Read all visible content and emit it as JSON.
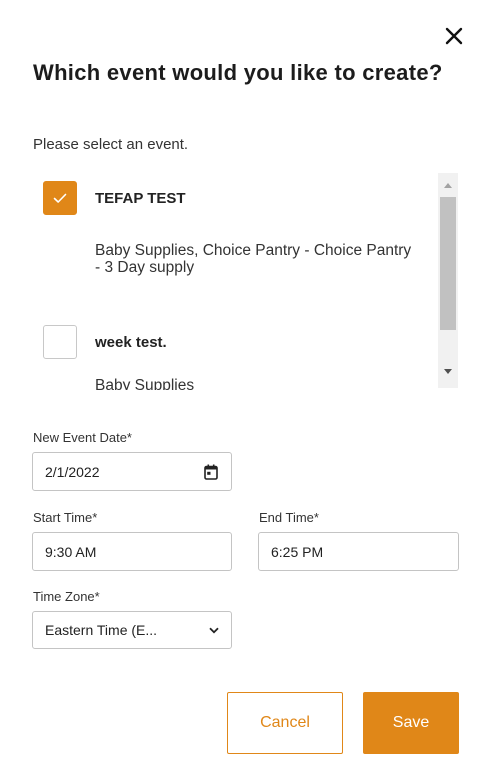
{
  "dialog": {
    "title": "Which event would you like to create?",
    "subtitle": "Please select an event.",
    "close_icon": "close-icon"
  },
  "events": [
    {
      "name": "TEFAP TEST",
      "description": "Baby Supplies, Choice Pantry - Choice Pantry - 3 Day supply",
      "checked": true
    },
    {
      "name": "week test.",
      "description": "Baby Supplies",
      "checked": false
    }
  ],
  "form": {
    "date_label": "New Event Date*",
    "date_value": "2/1/2022",
    "start_label": "Start Time*",
    "start_value": "9:30 AM",
    "end_label": "End Time*",
    "end_value": "6:25 PM",
    "tz_label": "Time Zone*",
    "tz_value": "Eastern Time (E..."
  },
  "buttons": {
    "cancel": "Cancel",
    "save": "Save"
  },
  "colors": {
    "accent": "#e08718",
    "border": "#c4c4c4",
    "text": "#222222"
  }
}
